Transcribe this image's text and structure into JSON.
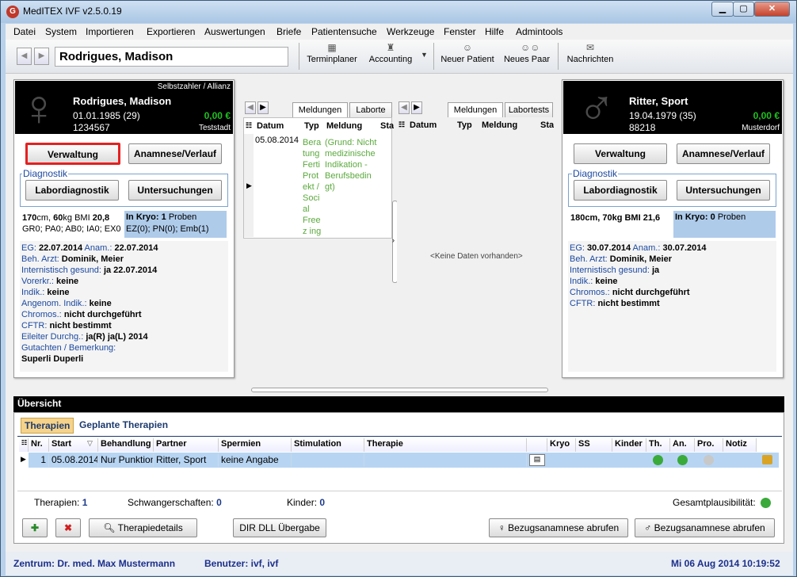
{
  "window": {
    "title": "MedITEX IVF v2.5.0.19",
    "app_icon": "G"
  },
  "menu": [
    "Datei",
    "System",
    "Importieren",
    "Exportieren",
    "Auswertungen",
    "Briefe",
    "Patientensuche",
    "Werkzeuge",
    "Fenster",
    "Hilfe",
    "Admintools"
  ],
  "toolbar": {
    "patient": "Rodrigues, Madison",
    "terminplaner": "Terminplaner",
    "accounting": "Accounting",
    "neuer_patient": "Neuer Patient",
    "neues_paar": "Neues Paar",
    "nachrichten": "Nachrichten"
  },
  "female": {
    "insurance": "Selbstzahler / Allianz",
    "name": "Rodrigues, Madison",
    "dob": "01.01.1985",
    "age": "(29)",
    "id": "1234567",
    "balance": "0,00 €",
    "city": "Teststadt",
    "btn_verwaltung": "Verwaltung",
    "btn_anamnese": "Anamnese/Verlauf",
    "diag_label": "Diagnostik",
    "btn_labor": "Labordiagnostik",
    "btn_untersuchungen": "Untersuchungen",
    "body_a": "170",
    "body_a_unit": "cm,",
    "body_b": "60",
    "body_b_unit": "kg BMI",
    "bmi": "20,8",
    "gravida": "GR0; PA0; AB0; IA0; EX0",
    "kryo_label": "In Kryo:",
    "kryo_val": "1",
    "kryo_unit": "Proben",
    "kryo_line2": "EZ(0); PN(0); Emb(1)",
    "eg_label": "EG:",
    "eg": "22.07.2014",
    "anam_label": "Anam.:",
    "anam": "22.07.2014",
    "arzt_label": "Beh. Arzt:",
    "arzt": "Dominik, Meier",
    "intern_label": "Internistisch gesund:",
    "intern": "ja 22.07.2014",
    "vorerkr_label": "Vorerkr.:",
    "vorerkr": "keine",
    "indik_label": "Indik.:",
    "indik": "keine",
    "angenom_label": "Angenom. Indik.:",
    "angenom": "keine",
    "chromos_label": "Chromos.:",
    "chromos": "nicht durchgeführt",
    "cftr_label": "CFTR:",
    "cftr": "nicht bestimmt",
    "eileiter_label": "Eileiter Durchg.:",
    "eileiter": "ja(R) ja(L) 2014",
    "gutachten_label": "Gutachten / Bemerkung:",
    "gutachten": "Superli Duperli"
  },
  "male": {
    "name": "Ritter, Sport",
    "dob": "19.04.1979",
    "age": "(35)",
    "id": "88218",
    "balance": "0,00 €",
    "city": "Musterdorf",
    "btn_verwaltung": "Verwaltung",
    "btn_anamnese": "Anamnese/Verlauf",
    "diag_label": "Diagnostik",
    "btn_labor": "Labordiagnostik",
    "btn_untersuchungen": "Untersuchungen",
    "body": "180cm, 70kg BMI 21,6",
    "kryo_label": "In Kryo:",
    "kryo_val": "0",
    "kryo_unit": "Proben",
    "eg_label": "EG:",
    "eg": "30.07.2014",
    "anam_label": "Anam.:",
    "anam": "30.07.2014",
    "arzt_label": "Beh. Arzt:",
    "arzt": "Dominik, Meier",
    "intern_label": "Internistisch gesund:",
    "intern": "ja",
    "indik_label": "Indik.:",
    "indik": "keine",
    "chromos_label": "Chromos.:",
    "chromos": "nicht durchgeführt",
    "cftr_label": "CFTR:",
    "cftr": "nicht bestimmt"
  },
  "messages_left": {
    "tab1": "Meldungen",
    "tab2": "Laborte",
    "col_datum": "Datum",
    "col_typ": "Typ",
    "col_meldung": "Meldung",
    "col_sta": "Sta",
    "row_date": "05.08.2014",
    "row_typ": "Bera tung Ferti Prot ekt / Soci al Freez ing",
    "row_meldung": "(Grund: Nicht medizinische Indikation - Berufsbedin gt)"
  },
  "messages_right": {
    "tab1": "Meldungen",
    "tab2": "Labortests",
    "col_datum": "Datum",
    "col_typ": "Typ",
    "col_meldung": "Meldung",
    "col_sta": "Sta",
    "empty": "<Keine Daten vorhanden>"
  },
  "overview": {
    "title": "Übersicht",
    "tab_therapien": "Therapien",
    "tab_geplant": "Geplante Therapien",
    "cols": [
      "Nr.",
      "Start",
      "Behandlung",
      "Partner",
      "Spermien",
      "Stimulation",
      "Therapie",
      "Kryo",
      "SS",
      "Kinder",
      "Th.",
      "An.",
      "Pro.",
      "Notiz"
    ],
    "row": {
      "nr": "1",
      "start": "05.08.2014",
      "behandlung": "Nur Punktion",
      "partner": "Ritter, Sport",
      "spermien": "keine Angabe",
      "stimulation": "",
      "therapie": ""
    },
    "therapien_label": "Therapien:",
    "therapien": "1",
    "ss_label": "Schwangerschaften:",
    "ss": "0",
    "kinder_label": "Kinder:",
    "kinder": "0",
    "plaus_label": "Gesamtplausibilität:",
    "btn_details": "Therapiedetails",
    "btn_dll": "DIR DLL Übergabe",
    "btn_bezug_f": "Bezugsanamnese abrufen",
    "btn_bezug_m": "Bezugsanamnese abrufen"
  },
  "status": {
    "zentrum": "Zentrum: Dr. med. Max Mustermann",
    "benutzer": "Benutzer: ivf, ivf",
    "datetime": "Mi 06 Aug 2014 10:19:52"
  }
}
